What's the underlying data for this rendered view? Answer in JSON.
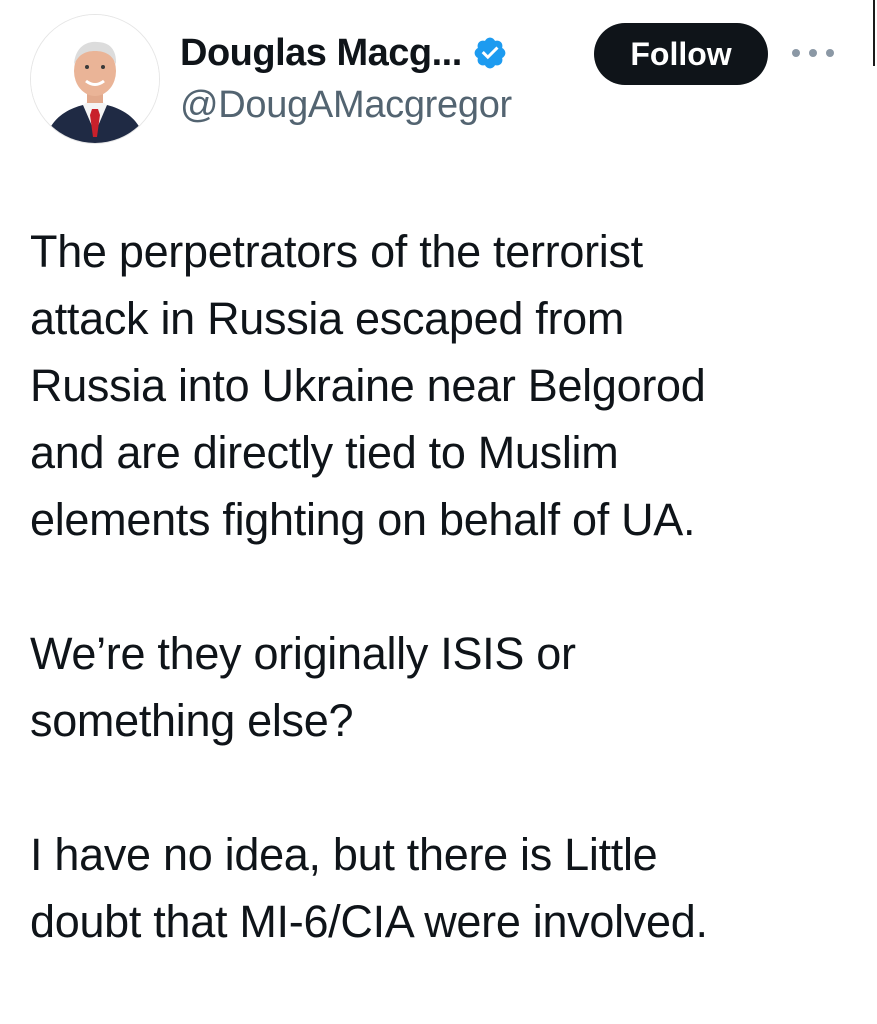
{
  "author": {
    "display_name": "Douglas Macg...",
    "handle": "@DougAMacgregor",
    "verified_icon": "verified-badge-icon",
    "avatar_icon": "profile-photo"
  },
  "actions": {
    "follow_label": "Follow",
    "more_icon": "more-options-icon"
  },
  "tweet": {
    "paragraphs": [
      {
        "lines": [
          "The perpetrators of the terrorist",
          "attack in Russia escaped from",
          "Russia into Ukraine near Belgorod",
          "and are directly tied to Muslim",
          "elements fighting on behalf of UA."
        ]
      },
      {
        "lines": [
          "We’re they originally ISIS or",
          "something else?"
        ]
      },
      {
        "lines": [
          "I have no idea, but there is Little",
          "doubt that MI-6/CIA were involved."
        ]
      }
    ]
  },
  "colors": {
    "text_primary": "#0f1419",
    "text_secondary": "#536471",
    "verified_blue": "#1d9bf0",
    "follow_bg": "#0f1419",
    "follow_text": "#ffffff"
  }
}
